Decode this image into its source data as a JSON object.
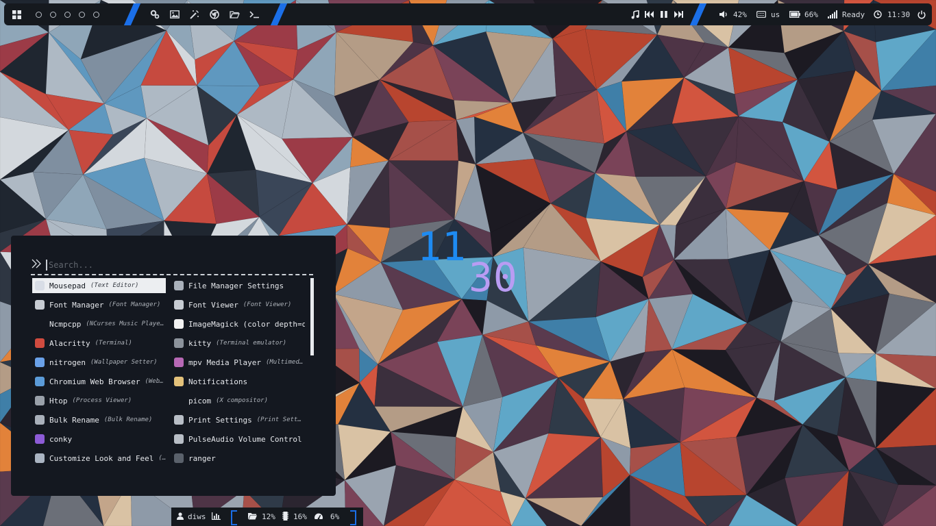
{
  "topbar": {
    "workspaces": [
      "ws1",
      "ws2",
      "ws3",
      "ws4",
      "ws5"
    ],
    "launchers": [
      "settings-icon",
      "image-viewer-icon",
      "color-picker-icon",
      "browser-icon",
      "file-manager-icon",
      "terminal-icon"
    ],
    "media": [
      "music-note-icon",
      "previous-icon",
      "pause-icon",
      "next-icon"
    ],
    "volume": "42%",
    "keyboard_layout": "us",
    "battery": "66%",
    "network": "Ready",
    "time": "11:30"
  },
  "desktop_clock": {
    "hour": "11",
    "minute": "30"
  },
  "launcher": {
    "placeholder": "Search...",
    "apps": [
      {
        "name": "Mousepad",
        "desc": "(Text Editor)",
        "icon": "text-editor-icon",
        "color": "#d8dde6",
        "selected": true
      },
      {
        "name": "File Manager Settings",
        "desc": "",
        "icon": "file-manager-settings-icon",
        "color": "#a9b0ba"
      },
      {
        "name": "Font Manager",
        "desc": "(Font Manager)",
        "icon": "font-manager-icon",
        "color": "#c7ccd3"
      },
      {
        "name": "Font Viewer",
        "desc": "(Font Viewer)",
        "icon": "font-viewer-icon",
        "color": "#c7ccd3"
      },
      {
        "name": "Ncmpcpp",
        "desc": "(NCurses Music Player …",
        "icon": "",
        "color": ""
      },
      {
        "name": "ImageMagick (color depth=q…",
        "desc": "",
        "icon": "imagemagick-icon",
        "color": "#f2f2f2"
      },
      {
        "name": "Alacritty",
        "desc": "(Terminal)",
        "icon": "alacritty-icon",
        "color": "#d04b3f"
      },
      {
        "name": "kitty",
        "desc": "(Terminal emulator)",
        "icon": "kitty-icon",
        "color": "#8c939c"
      },
      {
        "name": "nitrogen",
        "desc": "(Wallpaper Setter)",
        "icon": "nitrogen-icon",
        "color": "#6aa1e8"
      },
      {
        "name": "mpv Media Player",
        "desc": "(Multimedia…",
        "icon": "mpv-icon",
        "color": "#b768b5"
      },
      {
        "name": "Chromium Web Browser",
        "desc": "(Web B…",
        "icon": "chromium-icon",
        "color": "#5b9bd8"
      },
      {
        "name": "Notifications",
        "desc": "",
        "icon": "notifications-icon",
        "color": "#e3c17a"
      },
      {
        "name": "Htop",
        "desc": "(Process Viewer)",
        "icon": "htop-icon",
        "color": "#9aa1aa"
      },
      {
        "name": "picom",
        "desc": "(X compositor)",
        "icon": "",
        "color": ""
      },
      {
        "name": "Bulk Rename",
        "desc": "(Bulk Rename)",
        "icon": "bulk-rename-icon",
        "color": "#a9b0ba"
      },
      {
        "name": "Print Settings",
        "desc": "(Print Setting…",
        "icon": "print-settings-icon",
        "color": "#b8bec6"
      },
      {
        "name": "conky",
        "desc": "",
        "icon": "conky-icon",
        "color": "#8d5bd6"
      },
      {
        "name": "PulseAudio Volume Control …",
        "desc": "",
        "icon": "pulseaudio-icon",
        "color": "#b8bec6"
      },
      {
        "name": "Customize Look and Feel",
        "desc": "(Cu…",
        "icon": "customize-look-icon",
        "color": "#aab4c2"
      },
      {
        "name": "ranger",
        "desc": "",
        "icon": "ranger-icon",
        "color": "#5a616b"
      }
    ]
  },
  "bottombar": {
    "user": "diws",
    "disk": "12%",
    "memory": "16%",
    "cpu": "6%"
  }
}
